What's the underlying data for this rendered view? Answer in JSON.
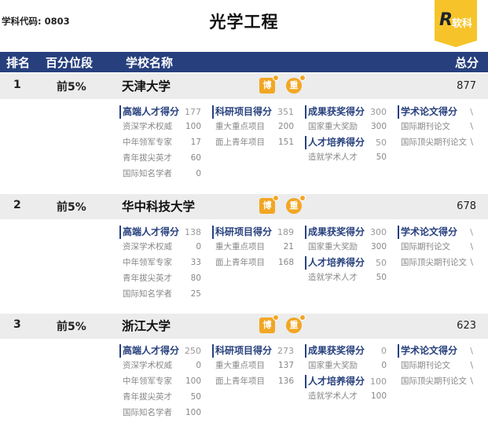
{
  "header": {
    "code": "学科代码: 0803",
    "title": "光学工程",
    "logo_r": "R",
    "logo_text": "软科",
    "accent": "#27407d",
    "logo_color": "#f6c42a"
  },
  "columns": {
    "rank": "排名",
    "percentile": "百分位段",
    "school": "学校名称",
    "total": "总分"
  },
  "badges": {
    "bo": "博",
    "zhong": "重"
  },
  "schools": [
    {
      "rank": "1",
      "percentile": "前5%",
      "name": "天津大学",
      "score": "877",
      "talent": {
        "label": "高端人才得分",
        "value": "177",
        "items": [
          {
            "label": "资深学术权威",
            "value": "100"
          },
          {
            "label": "中年领军专家",
            "value": "17"
          },
          {
            "label": "青年拔尖英才",
            "value": "60"
          },
          {
            "label": "国际知名学者",
            "value": "0"
          }
        ]
      },
      "research": {
        "label": "科研项目得分",
        "value": "351",
        "items": [
          {
            "label": "重大重点项目",
            "value": "200"
          },
          {
            "label": "面上青年项目",
            "value": "151"
          }
        ]
      },
      "award": {
        "label": "成果获奖得分",
        "value": "300",
        "items": [
          {
            "label": "国家重大奖励",
            "value": "300"
          }
        ]
      },
      "training": {
        "label": "人才培养得分",
        "value": "50",
        "items": [
          {
            "label": "造就学术人才",
            "value": "50"
          }
        ]
      },
      "paper": {
        "label": "学术论文得分",
        "value": "\\",
        "items": [
          {
            "label": "国际期刊论文",
            "value": "\\"
          },
          {
            "label": "国际顶尖期刊论文",
            "value": "\\"
          }
        ]
      }
    },
    {
      "rank": "2",
      "percentile": "前5%",
      "name": "华中科技大学",
      "score": "678",
      "talent": {
        "label": "高端人才得分",
        "value": "138",
        "items": [
          {
            "label": "资深学术权威",
            "value": "0"
          },
          {
            "label": "中年领军专家",
            "value": "33"
          },
          {
            "label": "青年拔尖英才",
            "value": "80"
          },
          {
            "label": "国际知名学者",
            "value": "25"
          }
        ]
      },
      "research": {
        "label": "科研项目得分",
        "value": "189",
        "items": [
          {
            "label": "重大重点项目",
            "value": "21"
          },
          {
            "label": "面上青年项目",
            "value": "168"
          }
        ]
      },
      "award": {
        "label": "成果获奖得分",
        "value": "300",
        "items": [
          {
            "label": "国家重大奖励",
            "value": "300"
          }
        ]
      },
      "training": {
        "label": "人才培养得分",
        "value": "50",
        "items": [
          {
            "label": "造就学术人才",
            "value": "50"
          }
        ]
      },
      "paper": {
        "label": "学术论文得分",
        "value": "\\",
        "items": [
          {
            "label": "国际期刊论文",
            "value": "\\"
          },
          {
            "label": "国际顶尖期刊论文",
            "value": "\\"
          }
        ]
      }
    },
    {
      "rank": "3",
      "percentile": "前5%",
      "name": "浙江大学",
      "score": "623",
      "talent": {
        "label": "高端人才得分",
        "value": "250",
        "items": [
          {
            "label": "资深学术权威",
            "value": "0"
          },
          {
            "label": "中年领军专家",
            "value": "100"
          },
          {
            "label": "青年拔尖英才",
            "value": "50"
          },
          {
            "label": "国际知名学者",
            "value": "100"
          }
        ]
      },
      "research": {
        "label": "科研项目得分",
        "value": "273",
        "items": [
          {
            "label": "重大重点项目",
            "value": "137"
          },
          {
            "label": "面上青年项目",
            "value": "136"
          }
        ]
      },
      "award": {
        "label": "成果获奖得分",
        "value": "0",
        "items": [
          {
            "label": "国家重大奖励",
            "value": "0"
          }
        ]
      },
      "training": {
        "label": "人才培养得分",
        "value": "100",
        "items": [
          {
            "label": "造就学术人才",
            "value": "100"
          }
        ]
      },
      "paper": {
        "label": "学术论文得分",
        "value": "\\",
        "items": [
          {
            "label": "国际期刊论文",
            "value": "\\"
          },
          {
            "label": "国际顶尖期刊论文",
            "value": "\\"
          }
        ]
      }
    }
  ]
}
